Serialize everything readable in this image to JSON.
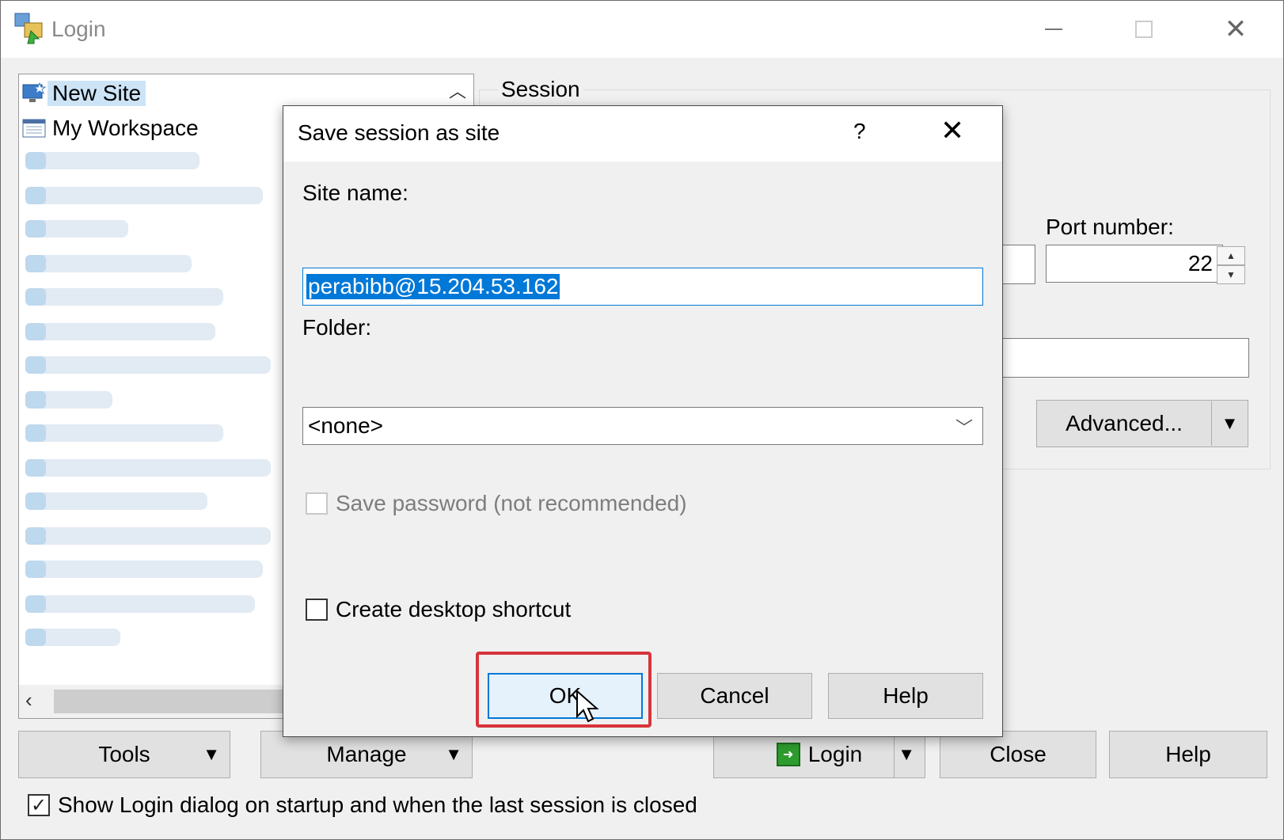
{
  "window": {
    "title": "Login"
  },
  "site_tree": {
    "items": [
      {
        "label": "New Site",
        "icon": "new-site-icon"
      },
      {
        "label": "My Workspace",
        "icon": "workspace-icon"
      }
    ]
  },
  "session": {
    "group_title": "Session",
    "port_label": "Port number:",
    "port_value": "22",
    "advanced_button": "Advanced..."
  },
  "bottom_bar": {
    "tools": "Tools",
    "manage": "Manage",
    "login": "Login",
    "close": "Close",
    "help": "Help",
    "show_login_label": "Show Login dialog on startup and when the last session is closed"
  },
  "dialog": {
    "title": "Save session as site",
    "help_glyph": "?",
    "site_name_label": "Site name:",
    "site_name_value": "perabibb@15.204.53.162",
    "folder_label": "Folder:",
    "folder_value": "<none>",
    "save_password_label": "Save password (not recommended)",
    "desktop_shortcut_label": "Create desktop shortcut",
    "ok": "OK",
    "cancel": "Cancel",
    "help": "Help"
  },
  "colors": {
    "accent": "#0078d7",
    "highlight": "#d7343c",
    "selected_row": "#cde4f7"
  }
}
